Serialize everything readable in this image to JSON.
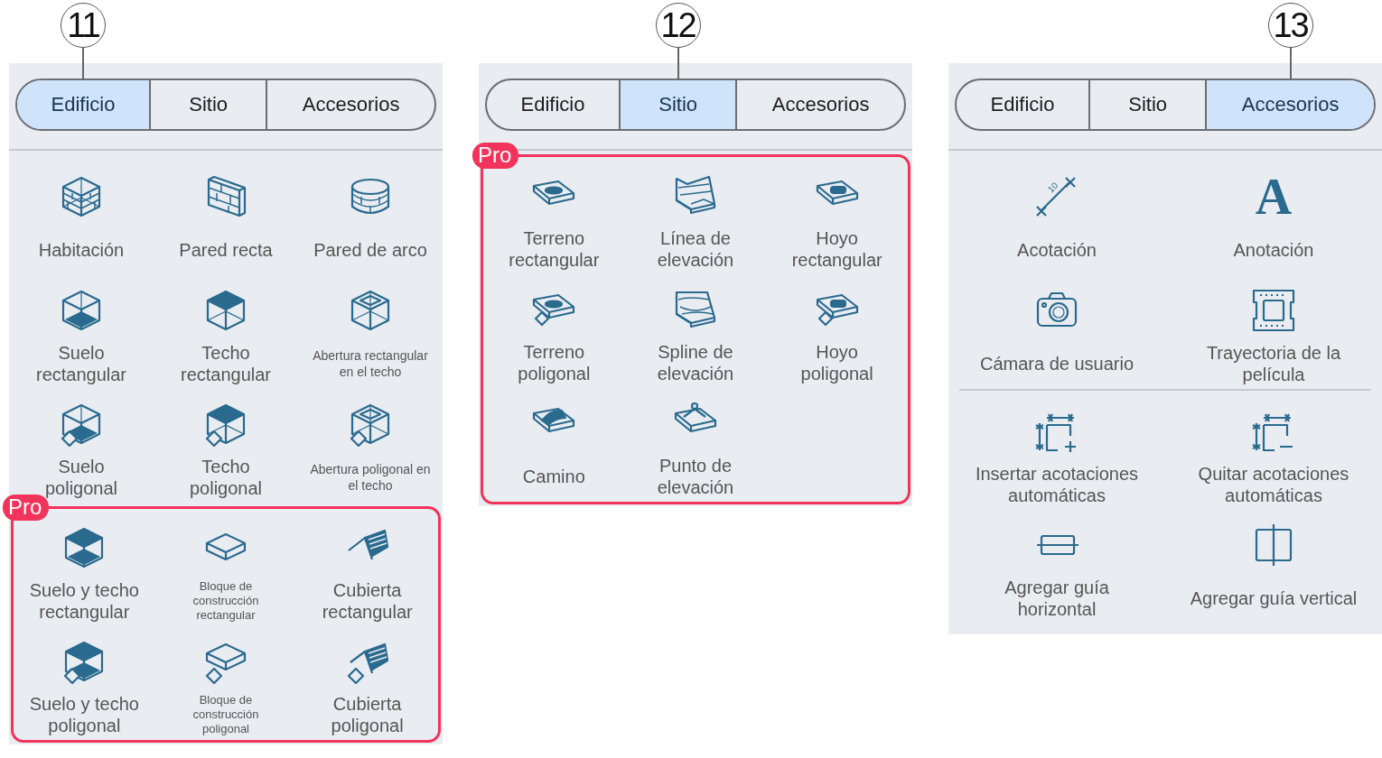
{
  "panels": [
    {
      "callout": "11",
      "tabs": [
        {
          "label": "Edificio",
          "selected": true
        },
        {
          "label": "Sitio",
          "selected": false
        },
        {
          "label": "Accesorios",
          "selected": false
        }
      ],
      "sections": [
        {
          "pro": false,
          "items": [
            {
              "label": "Habitación",
              "kind": "room"
            },
            {
              "label": "Pared recta",
              "kind": "wall"
            },
            {
              "label": "Pared de arco",
              "kind": "arcwall"
            },
            {
              "label": "Suelo rectangular",
              "kind": "floorrect"
            },
            {
              "label": "Techo rectangular",
              "kind": "ceilingrect"
            },
            {
              "label": "Abertura rectangular en el techo",
              "kind": "openingrect"
            },
            {
              "label": "Suelo poligonal",
              "kind": "floorpoly"
            },
            {
              "label": "Techo poligonal",
              "kind": "ceilingpoly"
            },
            {
              "label": "Abertura poligonal en el techo",
              "kind": "openingpoly"
            }
          ]
        },
        {
          "pro": true,
          "badge": "Pro",
          "items": [
            {
              "label": "Suelo y techo rectangular",
              "kind": "floorceilrect"
            },
            {
              "label": "Bloque de construcción rectangular",
              "kind": "blockrect"
            },
            {
              "label": "Cubierta rectangular",
              "kind": "roofrect"
            },
            {
              "label": "Suelo y techo poligonal",
              "kind": "floorceilpoly"
            },
            {
              "label": "Bloque de construcción poligonal",
              "kind": "blockpoly"
            },
            {
              "label": "Cubierta poligonal",
              "kind": "roofpoly"
            }
          ]
        }
      ]
    },
    {
      "callout": "12",
      "tabs": [
        {
          "label": "Edificio",
          "selected": false
        },
        {
          "label": "Sitio",
          "selected": true
        },
        {
          "label": "Accesorios",
          "selected": false
        }
      ],
      "sections": [
        {
          "pro": true,
          "badge": "Pro",
          "items": [
            {
              "label": "Terreno rectangular",
              "kind": "terrainrect"
            },
            {
              "label": "Línea de elevación",
              "kind": "elevline"
            },
            {
              "label": "Hoyo rectangular",
              "kind": "holerect"
            },
            {
              "label": "Terreno poligonal",
              "kind": "terrainpoly"
            },
            {
              "label": "Spline de elevación",
              "kind": "elevspline"
            },
            {
              "label": "Hoyo poligonal",
              "kind": "holepoly"
            },
            {
              "label": "Camino",
              "kind": "path"
            },
            {
              "label": "Punto de elevación",
              "kind": "elevpoint"
            }
          ]
        }
      ]
    },
    {
      "callout": "13",
      "tabs": [
        {
          "label": "Edificio",
          "selected": false
        },
        {
          "label": "Sitio",
          "selected": false
        },
        {
          "label": "Accesorios",
          "selected": true
        }
      ],
      "sections": [
        {
          "pro": false,
          "items": [
            {
              "label": "Acotación",
              "kind": "dimension",
              "glyph": "10"
            },
            {
              "label": "Anotación",
              "kind": "annotation",
              "glyph": "A"
            },
            {
              "label": "Cámara de usuario",
              "kind": "camera"
            },
            {
              "label": "Trayectoria de la película",
              "kind": "film"
            }
          ]
        },
        {
          "pro": false,
          "items": [
            {
              "label": "Insertar acotaciones automáticas",
              "kind": "autodimadd"
            },
            {
              "label": "Quitar acotaciones automáticas",
              "kind": "autodimremove"
            },
            {
              "label": "Agregar guía horizontal",
              "kind": "guideh"
            },
            {
              "label": "Agregar guía vertical",
              "kind": "guidev"
            }
          ]
        }
      ]
    }
  ]
}
